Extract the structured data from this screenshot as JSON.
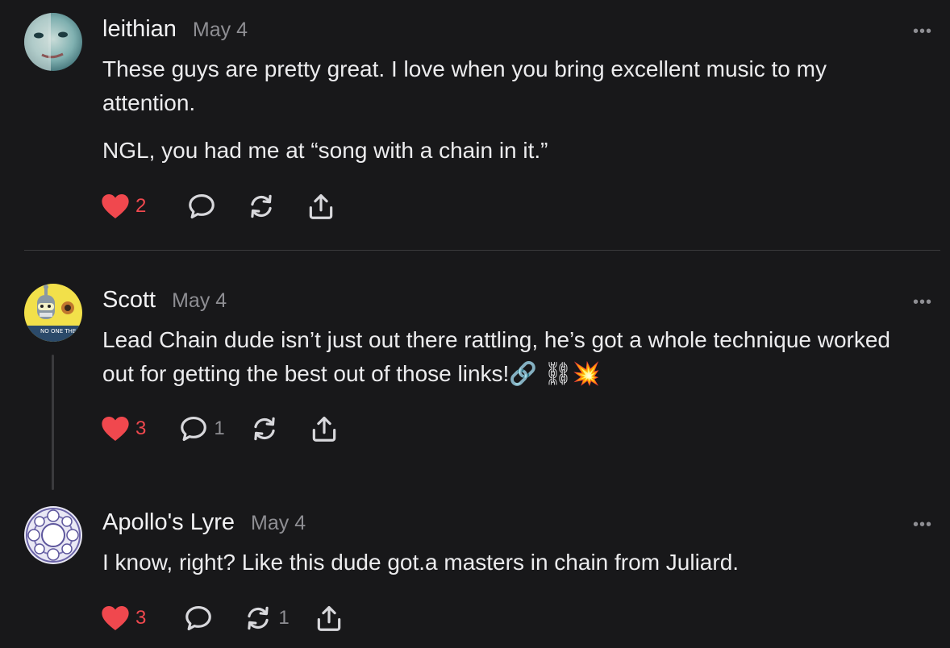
{
  "colors": {
    "background": "#18181a",
    "text": "#ececee",
    "muted": "#8e8e93",
    "like": "#f0484e",
    "divider": "#3a3a3c"
  },
  "comments": [
    {
      "author": "leithian",
      "date": "May 4",
      "more_label": "•••",
      "paragraphs": [
        "These guys are pretty great. I love when you bring excellent music to my attention.",
        "NGL, you had me at “song with a chain in it.”"
      ],
      "likes": "2",
      "replies": "",
      "restacks": "",
      "icons": [
        "heart-icon",
        "comment-icon",
        "restack-icon",
        "share-icon"
      ]
    },
    {
      "author": "Scott",
      "date": "May 4",
      "more_label": "•••",
      "paragraphs": [
        "Lead Chain dude isn’t just out there rattling, he’s got a whole technique worked out for getting the best out of those links!🔗 ⛓💥"
      ],
      "likes": "3",
      "replies": "1",
      "restacks": "",
      "avatar_text": "NO ONE THE",
      "icons": [
        "heart-icon",
        "comment-icon",
        "restack-icon",
        "share-icon"
      ]
    },
    {
      "author": "Apollo's Lyre",
      "date": "May 4",
      "more_label": "•••",
      "paragraphs": [
        "I know, right? Like this dude got.a masters in chain from Juliard."
      ],
      "likes": "3",
      "replies": "",
      "restacks": "1",
      "icons": [
        "heart-icon",
        "comment-icon",
        "restack-icon",
        "share-icon"
      ]
    }
  ]
}
